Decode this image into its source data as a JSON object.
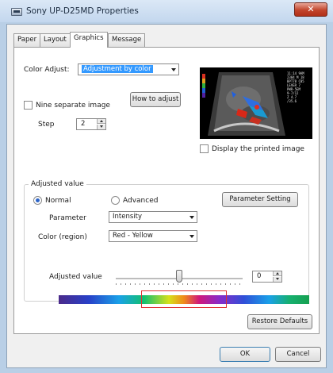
{
  "window": {
    "title": "Sony UP-D25MD Properties",
    "close_glyph": "✕"
  },
  "tabs": [
    {
      "label": "Paper",
      "active": false
    },
    {
      "label": "Layout",
      "active": false
    },
    {
      "label": "Graphics",
      "active": true
    },
    {
      "label": "Message",
      "active": false
    }
  ],
  "graphics": {
    "color_adjust_label": "Color Adjust:",
    "color_adjust_value": "Adjustment by color",
    "how_to_adjust_label": "How to adjust",
    "nine_separate_label": "Nine separate image",
    "nine_separate_checked": false,
    "step_label": "Step",
    "step_value": "2",
    "display_printed_label": "Display the printed image",
    "display_printed_checked": false,
    "preview_readout": [
      "11:14 9AM",
      "2304 M 18",
      "BPT78 C05",
      "LEVER   7",
      "",
      "PWR-5EM",
      "9-7/12",
      "Z 4.7",
      "/35.6"
    ]
  },
  "adjusted": {
    "legend": "Adjusted value",
    "mode_normal_label": "Normal",
    "mode_advanced_label": "Advanced",
    "mode_selected": "Normal",
    "parameter_setting_label": "Parameter Setting",
    "parameter_label": "Parameter",
    "parameter_value": "Intensity",
    "color_region_label": "Color (region)",
    "color_region_value": "Red - Yellow",
    "adjusted_value_label": "Adjusted value",
    "adjusted_value": "0",
    "slider_level": 0.5,
    "region_selection": [
      0.33,
      0.67
    ]
  },
  "buttons": {
    "restore_defaults": "Restore Defaults",
    "ok": "OK",
    "cancel": "Cancel"
  },
  "colors": {
    "accent": "#3399ff",
    "title_bar": "#c3d7ee",
    "close_button": "#c2452c",
    "region_outline": "#e03030"
  }
}
